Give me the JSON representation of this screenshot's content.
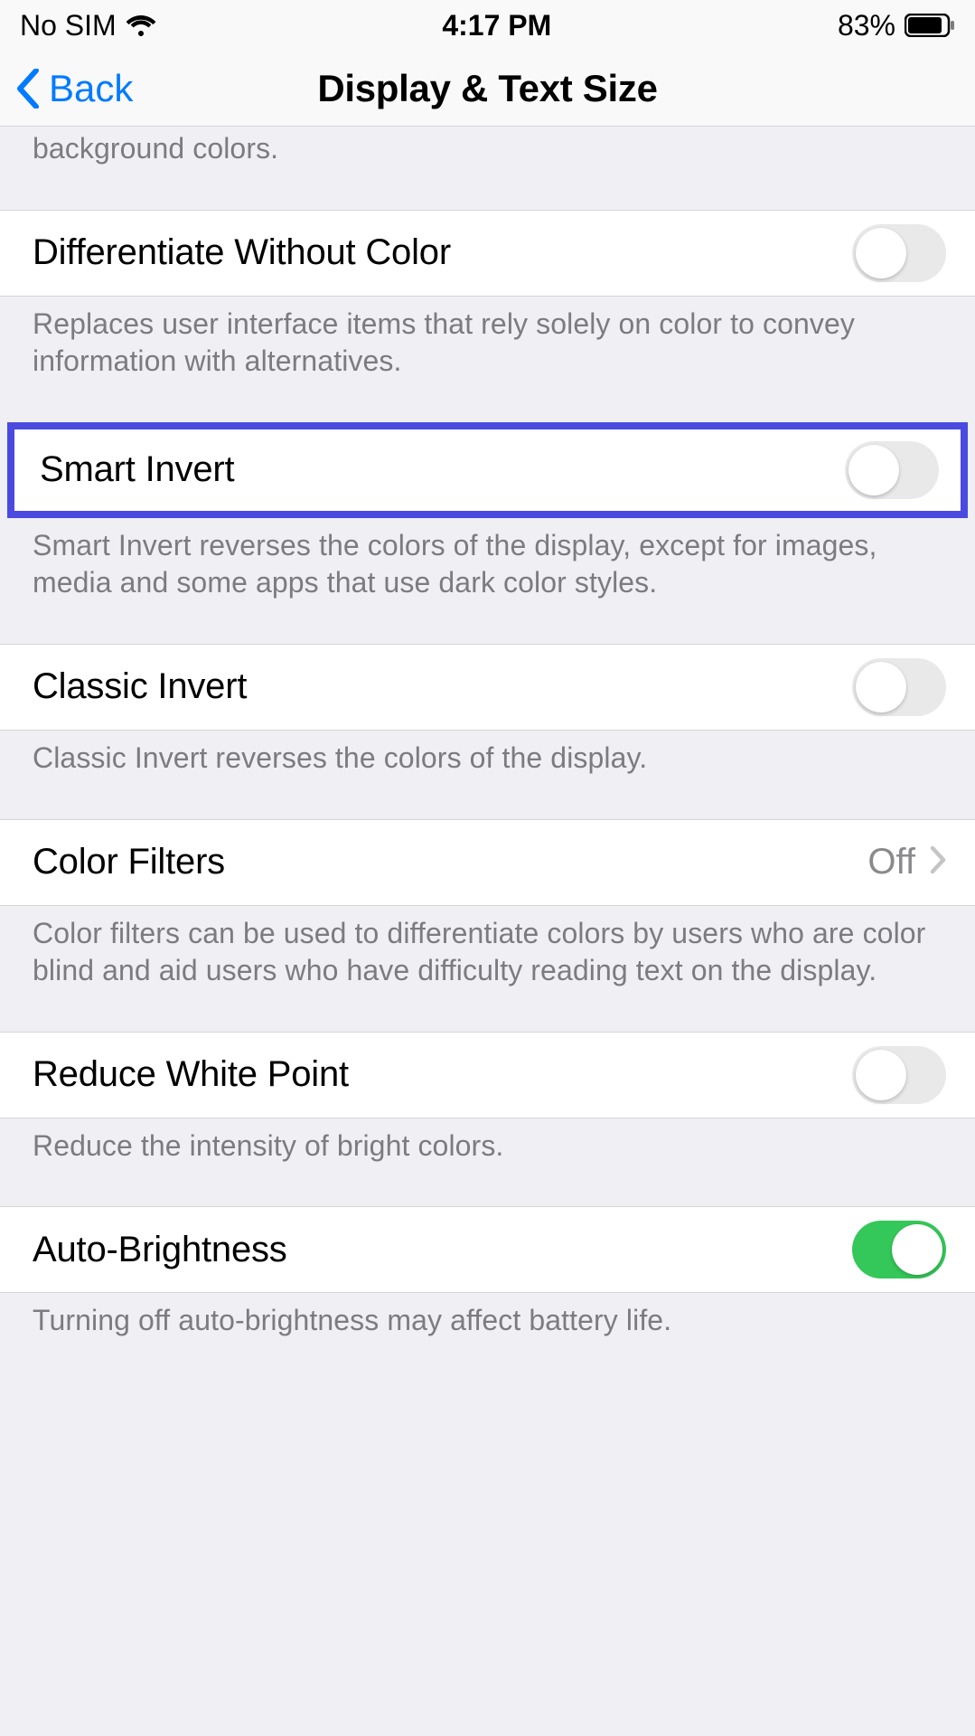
{
  "status": {
    "carrier": "No SIM",
    "time": "4:17 PM",
    "battery_pct": "83%"
  },
  "nav": {
    "back_label": "Back",
    "title": "Display & Text Size"
  },
  "partial_footer_top": "background colors.",
  "rows": {
    "diff_without_color": {
      "label": "Differentiate Without Color",
      "footer": "Replaces user interface items that rely solely on color to convey information with alternatives.",
      "on": false
    },
    "smart_invert": {
      "label": "Smart Invert",
      "footer": "Smart Invert reverses the colors of the display, except for images, media and some apps that use dark color styles.",
      "on": false
    },
    "classic_invert": {
      "label": "Classic Invert",
      "footer": "Classic Invert reverses the colors of the display.",
      "on": false
    },
    "color_filters": {
      "label": "Color Filters",
      "value": "Off",
      "footer": "Color filters can be used to differentiate colors by users who are color blind and aid users who have difficulty reading text on the display."
    },
    "reduce_white_point": {
      "label": "Reduce White Point",
      "footer": "Reduce the intensity of bright colors.",
      "on": false
    },
    "auto_brightness": {
      "label": "Auto-Brightness",
      "footer": "Turning off auto-brightness may affect battery life.",
      "on": true
    }
  }
}
